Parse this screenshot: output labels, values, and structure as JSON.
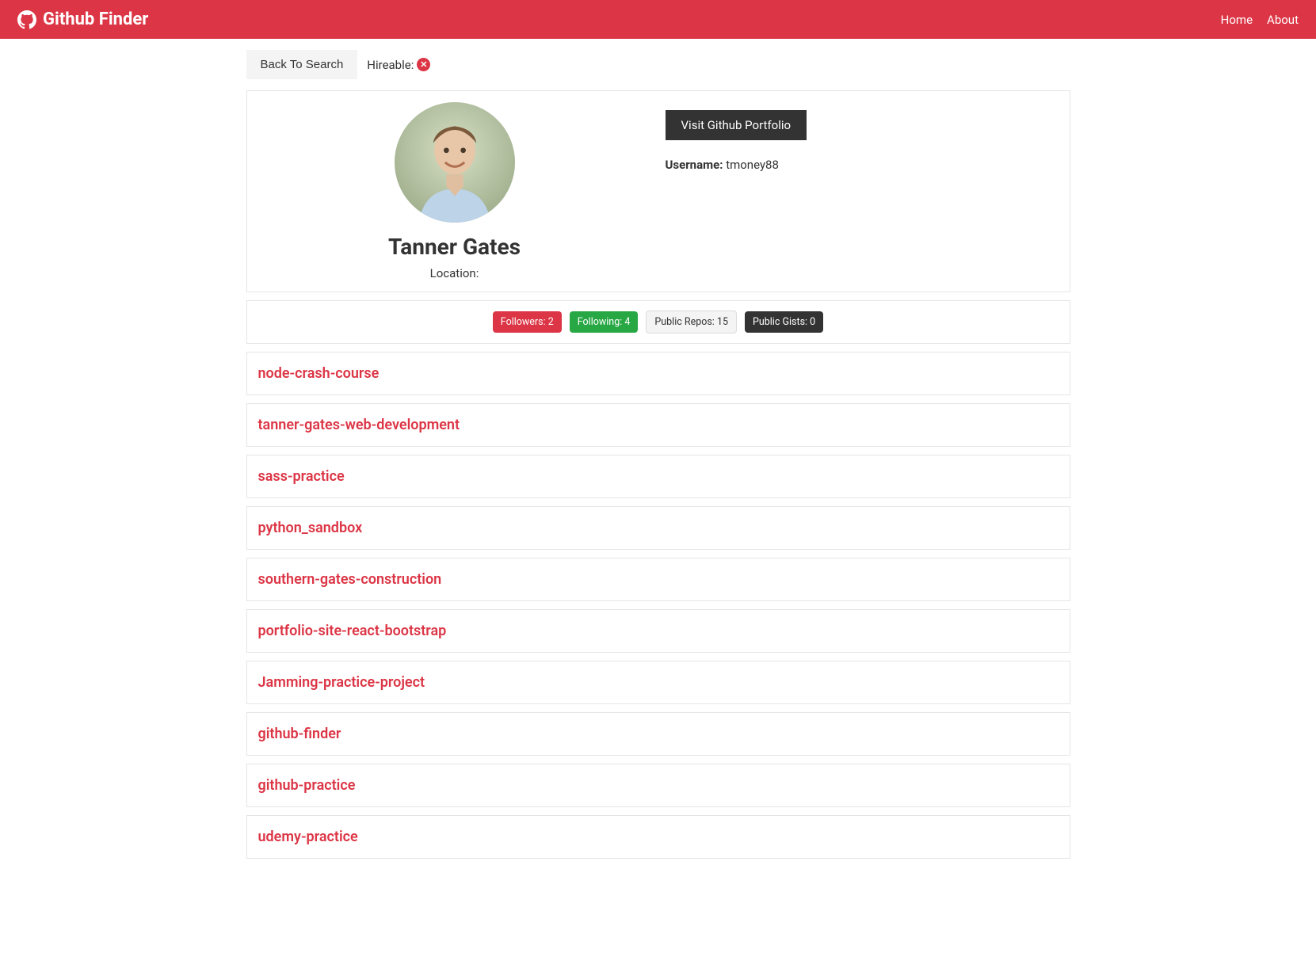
{
  "navbar": {
    "title": "Github Finder",
    "links": [
      "Home",
      "About"
    ]
  },
  "back_label": "Back To Search",
  "hireable": {
    "label": "Hireable:",
    "status": "false"
  },
  "profile": {
    "name": "Tanner Gates",
    "location_label": "Location:",
    "location": "",
    "visit_button": "Visit Github Portfolio",
    "username_label": "Username:",
    "username": "tmoney88"
  },
  "badges": {
    "followers": "Followers: 2",
    "following": "Following: 4",
    "public_repos": "Public Repos: 15",
    "public_gists": "Public Gists: 0"
  },
  "repos": [
    "node-crash-course",
    "tanner-gates-web-development",
    "sass-practice",
    "python_sandbox",
    "southern-gates-construction",
    "portfolio-site-react-bootstrap",
    "Jamming-practice-project",
    "github-finder",
    "github-practice",
    "udemy-practice"
  ]
}
